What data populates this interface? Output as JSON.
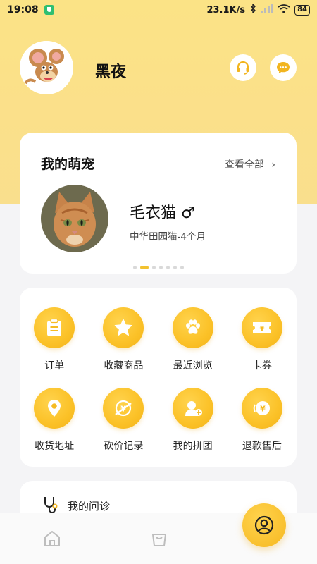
{
  "status_bar": {
    "time": "19:08",
    "network_speed": "23.1K/s",
    "battery": "84",
    "icons": [
      "shield-icon",
      "bluetooth-icon",
      "signal-icon",
      "wifi-icon",
      "battery-icon"
    ]
  },
  "profile": {
    "username": "黑夜",
    "avatar": "cartoon-mouse-avatar",
    "actions": [
      "headset-icon",
      "message-icon"
    ]
  },
  "pets": {
    "title": "我的萌宠",
    "view_all": "查看全部",
    "pet": {
      "name": "毛衣猫 ♂",
      "description": "中华田园猫-4个月"
    },
    "pager": {
      "count": 7,
      "active": 1
    }
  },
  "menu": {
    "items": [
      {
        "label": "订单",
        "icon": "clipboard-icon"
      },
      {
        "label": "收藏商品",
        "icon": "star-icon"
      },
      {
        "label": "最近浏览",
        "icon": "paw-icon"
      },
      {
        "label": "卡券",
        "icon": "coupon-icon"
      },
      {
        "label": "收货地址",
        "icon": "location-pin-icon"
      },
      {
        "label": "砍价记录",
        "icon": "bargain-icon"
      },
      {
        "label": "我的拼团",
        "icon": "group-buy-icon"
      },
      {
        "label": "退款售后",
        "icon": "refund-icon"
      }
    ]
  },
  "consult": {
    "label": "我的问诊",
    "icon": "stethoscope-icon"
  },
  "bottom_nav": {
    "items": [
      "home-icon",
      "shopping-bag-icon",
      "profile-icon"
    ],
    "active": "profile-icon"
  },
  "colors": {
    "accent": "#fbc127",
    "hero": "#fbe386"
  }
}
